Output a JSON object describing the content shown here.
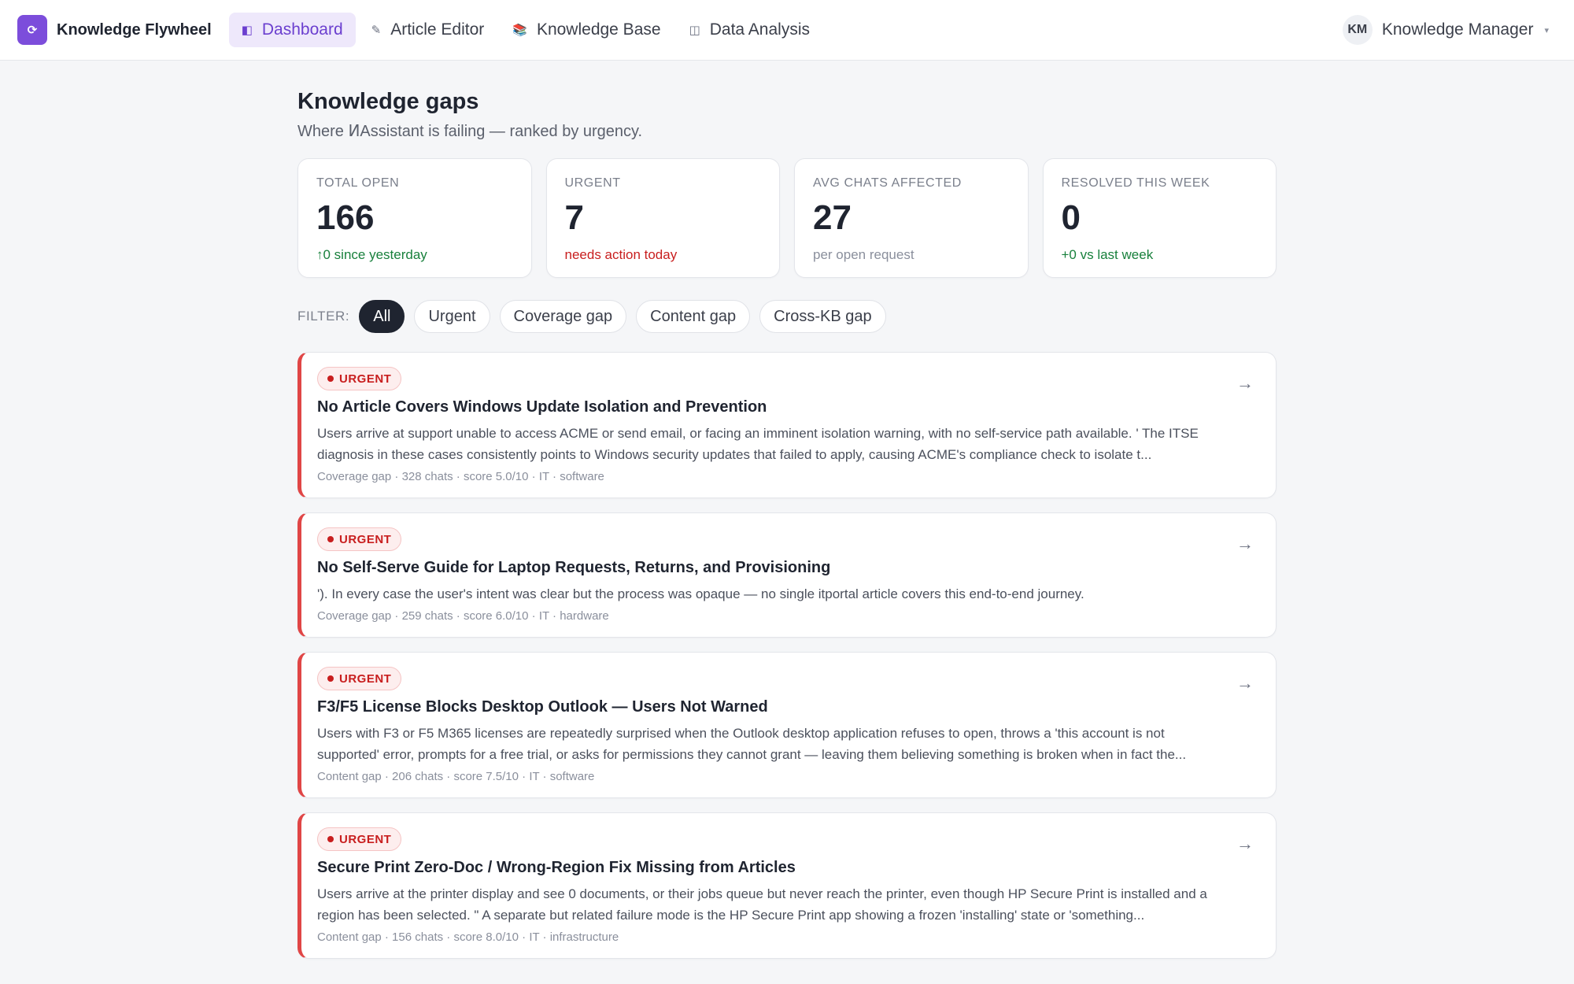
{
  "app": {
    "logo_glyph": "⟳",
    "name": "Knowledge Flywheel"
  },
  "nav": {
    "items": [
      {
        "label": "Dashboard",
        "icon": "◧",
        "icon_name": "dashboard-icon",
        "active": true
      },
      {
        "label": "Article Editor",
        "icon": "✎",
        "icon_name": "pencil-icon",
        "active": false
      },
      {
        "label": "Knowledge Base",
        "icon": "📚",
        "icon_name": "books-icon",
        "active": false
      },
      {
        "label": "Data Analysis",
        "icon": "◫",
        "icon_name": "columns-icon",
        "active": false
      }
    ]
  },
  "user": {
    "initials": "KM",
    "name": "Knowledge Manager",
    "caret": "▾"
  },
  "page": {
    "title": "Knowledge gaps",
    "subtitle": "Where ͶAssistant is failing — ranked by urgency."
  },
  "stats": [
    {
      "label": "TOTAL OPEN",
      "value": "166",
      "note": "↑0 since yesterday",
      "note_color": "green"
    },
    {
      "label": "URGENT",
      "value": "7",
      "note": "needs action today",
      "note_color": "red"
    },
    {
      "label": "AVG CHATS AFFECTED",
      "value": "27",
      "note": "per open request",
      "note_color": "gray"
    },
    {
      "label": "RESOLVED THIS WEEK",
      "value": "0",
      "note": "+0 vs last week",
      "note_color": "green"
    }
  ],
  "filter": {
    "label": "FILTER:",
    "options": [
      "All",
      "Urgent",
      "Coverage gap",
      "Content gap",
      "Cross-KB gap"
    ],
    "selected": "All"
  },
  "gaps": [
    {
      "badge": "URGENT",
      "title": "No Article Covers Windows Update Isolation and Prevention",
      "description": "Users arrive at support unable to access ACME or send email, or facing an imminent isolation warning, with no self-service path available. ' The ITSE diagnosis in these cases consistently points to Windows security updates that failed to apply, causing ACME's compliance check to isolate t...",
      "meta": "Coverage gap · 328 chats · score 5.0/10 · IT · software"
    },
    {
      "badge": "URGENT",
      "title": "No Self-Serve Guide for Laptop Requests, Returns, and Provisioning",
      "description": "'). In every case the user's intent was clear but the process was opaque — no single itportal article covers this end-to-end journey.",
      "meta": "Coverage gap · 259 chats · score 6.0/10 · IT · hardware"
    },
    {
      "badge": "URGENT",
      "title": "F3/F5 License Blocks Desktop Outlook — Users Not Warned",
      "description": "Users with F3 or F5 M365 licenses are repeatedly surprised when the Outlook desktop application refuses to open, throws a 'this account is not supported' error, prompts for a free trial, or asks for permissions they cannot grant — leaving them believing something is broken when in fact the...",
      "meta": "Content gap · 206 chats · score 7.5/10 · IT · software"
    },
    {
      "badge": "URGENT",
      "title": "Secure Print Zero-Doc / Wrong-Region Fix Missing from Articles",
      "description": "Users arrive at the printer display and see 0 documents, or their jobs queue but never reach the printer, even though HP Secure Print is installed and a region has been selected. \" A separate but related failure mode is the HP Secure Print app showing a frozen 'installing' state or 'something...",
      "meta": "Content gap · 156 chats · score 8.0/10 · IT · infrastructure"
    }
  ],
  "colors": {
    "brand": "#7c4ddb",
    "nav_active_bg": "#eee8fb",
    "urgent": "#e04646",
    "positive": "#18803c",
    "negative": "#c81e1e"
  }
}
